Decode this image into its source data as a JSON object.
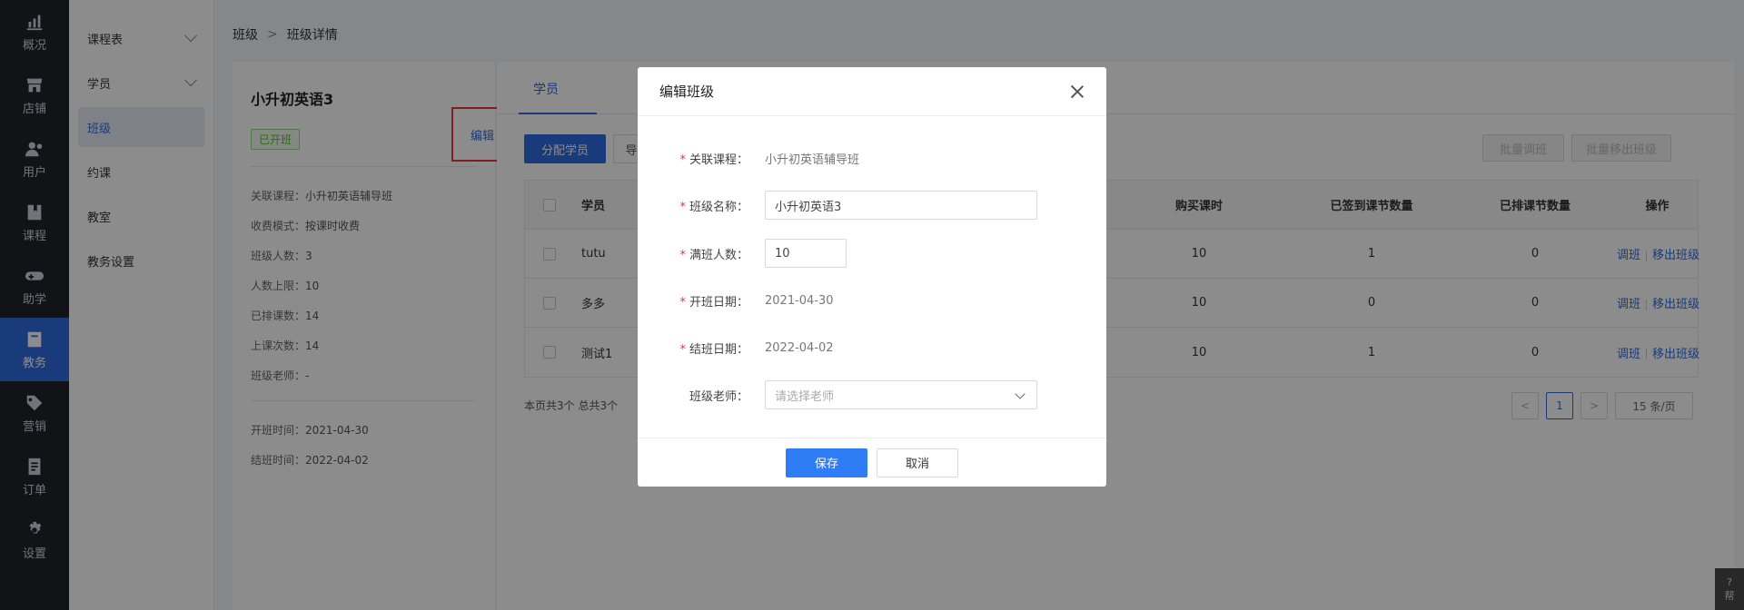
{
  "nav": [
    {
      "label": "概况",
      "icon": "chart-icon"
    },
    {
      "label": "店铺",
      "icon": "store-icon"
    },
    {
      "label": "用户",
      "icon": "users-icon"
    },
    {
      "label": "课程",
      "icon": "book-icon"
    },
    {
      "label": "助学",
      "icon": "gamepad-icon"
    },
    {
      "label": "教务",
      "icon": "edu-icon",
      "active": true
    },
    {
      "label": "营销",
      "icon": "tag-icon"
    },
    {
      "label": "订单",
      "icon": "order-icon"
    },
    {
      "label": "设置",
      "icon": "gear-icon"
    }
  ],
  "subnav": [
    {
      "label": "课程表"
    },
    {
      "label": "学员"
    },
    {
      "label": "班级"
    },
    {
      "label": "约课"
    },
    {
      "label": "教室"
    },
    {
      "label": "教务设置"
    }
  ],
  "breadcrumb": {
    "parent": "班级",
    "sep": ">",
    "current": "班级详情"
  },
  "class_info": {
    "title": "小升初英语3",
    "status": "已开班",
    "edit": "编辑",
    "rows": [
      {
        "k": "关联课程：",
        "v": "小升初英语辅导班"
      },
      {
        "k": "收费模式：",
        "v": "按课时收费"
      },
      {
        "k": "班级人数：",
        "v": "3"
      },
      {
        "k": "人数上限：",
        "v": "10"
      },
      {
        "k": "已排课数：",
        "v": "14"
      },
      {
        "k": "上课次数：",
        "v": "14"
      },
      {
        "k": "班级老师：",
        "v": "-"
      }
    ],
    "rows2": [
      {
        "k": "开班时间：",
        "v": "2021-04-30"
      },
      {
        "k": "结班时间：",
        "v": "2022-04-02"
      }
    ]
  },
  "tabs": {
    "students": "学员"
  },
  "toolbar": {
    "assign": "分配学员",
    "import": "导",
    "batch_transfer": "批量调班",
    "batch_remove": "批量移出班级"
  },
  "table": {
    "headers": {
      "student": "学员",
      "bought": "购买课时",
      "signed": "已签到课节数量",
      "scheduled": "已排课节数量",
      "ops": "操作"
    },
    "rows": [
      {
        "name": "tutu",
        "bought": "10",
        "signed": "1",
        "scheduled": "0"
      },
      {
        "name": "多多",
        "bought": "10",
        "signed": "0",
        "scheduled": "0"
      },
      {
        "name": "测试1",
        "bought": "10",
        "signed": "1",
        "scheduled": "0"
      }
    ],
    "op_transfer": "调班",
    "op_remove": "移出班级"
  },
  "pagination": {
    "summary": "本页共3个 总共3个",
    "page": "1",
    "prev": "<",
    "next": ">",
    "size": "15 条/页"
  },
  "modal": {
    "title": "编辑班级",
    "fields": {
      "course_label": "关联课程：",
      "course_value": "小升初英语辅导班",
      "name_label": "班级名称：",
      "name_value": "小升初英语3",
      "capacity_label": "满班人数：",
      "capacity_value": "10",
      "start_label": "开班日期：",
      "start_value": "2021-04-30",
      "end_label": "结班日期：",
      "end_value": "2022-04-02",
      "teacher_label": "班级老师：",
      "teacher_placeholder": "请选择老师"
    },
    "save": "保存",
    "cancel": "取消"
  },
  "help": {
    "label": "帮"
  }
}
